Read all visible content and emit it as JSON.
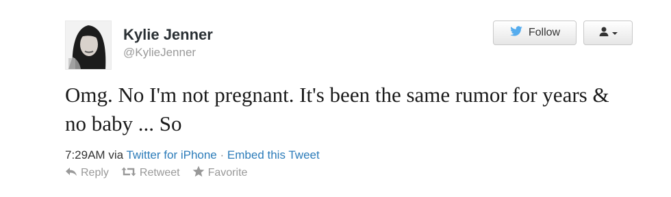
{
  "author": {
    "name": "Kylie Jenner",
    "handle": "@KylieJenner"
  },
  "header": {
    "follow_label": "Follow",
    "follow_icon": "bird-icon",
    "user_menu_icon": "user-dropdown-icon"
  },
  "tweet": {
    "text": "Omg. No I'm not pregnant. It's been the same rumor for years & no baby ... So"
  },
  "meta": {
    "time": "7:29AM",
    "via": "via",
    "source": "Twitter for iPhone",
    "separator": "·",
    "embed": "Embed this Tweet"
  },
  "actions": {
    "reply": "Reply",
    "retweet": "Retweet",
    "favorite": "Favorite"
  },
  "colors": {
    "link": "#2b7bb9",
    "muted": "#999999",
    "bird": "#55acee"
  }
}
